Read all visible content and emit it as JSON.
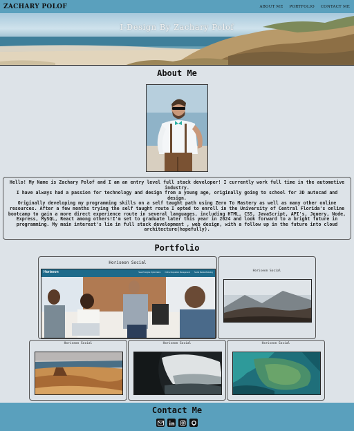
{
  "header": {
    "brand": "ZACHARY POLOF",
    "nav": [
      "ABOUT ME",
      "PORTFOLIO",
      "CONTACT ME"
    ]
  },
  "hero": {
    "title": "I-Design By Zachary Polof"
  },
  "about": {
    "title": "About Me",
    "bio": [
      "Hello! My Name is Zachary Polof and I am an entry level full stack developer! I currently work full time in the automotive industry.",
      "I have always had a passion for technology and design from a young age, originally going to school for 3D autocad and design.",
      "Originally developing my programming skills on a self taught path using Zero To Mastery as well as many other online resources. After a few months trying the self taught route I opted to enroll in the University of Central Florida's online bootcamp to gain a more direct experience route in several languages, including HTML, CSS, JavaScript, API's, Jquery, Node, Express, MySQL, React among others!I'm set to graduate later this year in 2024 and look forward to a bright future in programming. My main interest's lie in full stack development , web design, with a follow up in the future into cloud architecture(hopefully)."
    ]
  },
  "portfolio": {
    "title": "Portfolio",
    "cards": [
      {
        "title": "Horiseon Social",
        "image": "team-meeting"
      },
      {
        "title": "Horiseon Social",
        "image": "mountain-landscape"
      },
      {
        "title": "Horiseon Social",
        "image": "desert-canyon"
      },
      {
        "title": "Horiseon Social",
        "image": "sea-cave"
      },
      {
        "title": "Horiseon Social",
        "image": "aerial-coast"
      }
    ],
    "featured_banner": {
      "logo": "Horiseon",
      "links": [
        "Search Engine Optimization",
        "Online Reputation Management",
        "Social Media Marketing"
      ]
    }
  },
  "contact": {
    "title": "Contact Me",
    "icons": [
      "email-icon",
      "linkedin-icon",
      "instagram-icon",
      "github-icon"
    ]
  },
  "colors": {
    "accent": "#5aa0bd",
    "background": "#dde3e8",
    "text": "#111111"
  }
}
